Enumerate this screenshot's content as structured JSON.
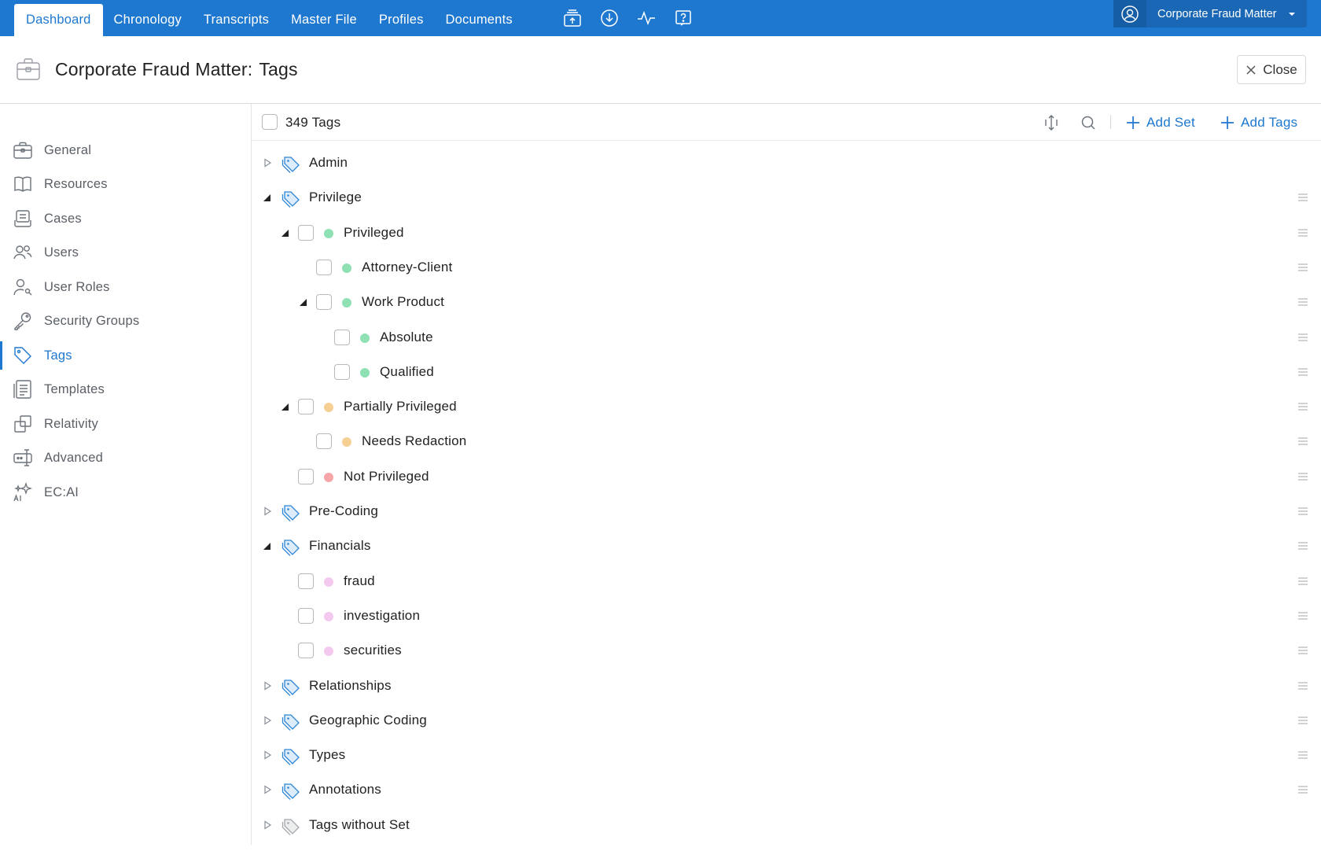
{
  "nav": {
    "tabs": [
      {
        "label": "Dashboard",
        "active": true
      },
      {
        "label": "Chronology"
      },
      {
        "label": "Transcripts"
      },
      {
        "label": "Master File"
      },
      {
        "label": "Profiles"
      },
      {
        "label": "Documents"
      }
    ],
    "icons": [
      "upload-stack-icon",
      "download-icon",
      "activity-icon",
      "help-icon"
    ],
    "matter": "Corporate Fraud Matter"
  },
  "header": {
    "title": "Corporate Fraud Matter:",
    "subtitle": "Tags",
    "close_label": "Close"
  },
  "sidebar": {
    "items": [
      {
        "label": "General",
        "icon": "briefcase-icon"
      },
      {
        "label": "Resources",
        "icon": "book-icon"
      },
      {
        "label": "Cases",
        "icon": "cases-icon"
      },
      {
        "label": "Users",
        "icon": "users-icon"
      },
      {
        "label": "User Roles",
        "icon": "user-roles-icon"
      },
      {
        "label": "Security Groups",
        "icon": "key-icon"
      },
      {
        "label": "Tags",
        "icon": "tag-icon",
        "active": true
      },
      {
        "label": "Templates",
        "icon": "templates-icon"
      },
      {
        "label": "Relativity",
        "icon": "relativity-icon"
      },
      {
        "label": "Advanced",
        "icon": "advanced-icon"
      },
      {
        "label": "EC:AI",
        "icon": "ai-sparkle-icon"
      }
    ]
  },
  "toolbar": {
    "count_label": "349 Tags",
    "add_set_label": "Add Set",
    "add_tags_label": "Add Tags"
  },
  "colors": {
    "accent": "#1e78cf",
    "green": "#8fe0b3",
    "orange": "#f5cf94",
    "red": "#f7a5a9",
    "pink": "#f3c9f0"
  },
  "tree": [
    {
      "label": "Admin",
      "kind": "set",
      "level": 0,
      "expanded": false
    },
    {
      "label": "Privilege",
      "kind": "set",
      "level": 0,
      "expanded": true
    },
    {
      "label": "Privileged",
      "kind": "tag",
      "level": 1,
      "color": "green",
      "expanded": true
    },
    {
      "label": "Attorney-Client",
      "kind": "tag",
      "level": 2,
      "color": "green"
    },
    {
      "label": "Work Product",
      "kind": "tag",
      "level": 2,
      "color": "green",
      "expanded": true
    },
    {
      "label": "Absolute",
      "kind": "tag",
      "level": 3,
      "color": "green"
    },
    {
      "label": "Qualified",
      "kind": "tag",
      "level": 3,
      "color": "green"
    },
    {
      "label": "Partially Privileged",
      "kind": "tag",
      "level": 1,
      "color": "orange",
      "expanded": true
    },
    {
      "label": "Needs Redaction",
      "kind": "tag",
      "level": 2,
      "color": "orange"
    },
    {
      "label": "Not Privileged",
      "kind": "tag",
      "level": 1,
      "color": "red"
    },
    {
      "label": "Pre-Coding",
      "kind": "set",
      "level": 0,
      "expanded": false
    },
    {
      "label": "Financials",
      "kind": "set",
      "level": 0,
      "expanded": true
    },
    {
      "label": "fraud",
      "kind": "tag",
      "level": 1,
      "color": "pink"
    },
    {
      "label": "investigation",
      "kind": "tag",
      "level": 1,
      "color": "pink"
    },
    {
      "label": "securities",
      "kind": "tag",
      "level": 1,
      "color": "pink"
    },
    {
      "label": "Relationships",
      "kind": "set",
      "level": 0,
      "expanded": false
    },
    {
      "label": "Geographic Coding",
      "kind": "set",
      "level": 0,
      "expanded": false
    },
    {
      "label": "Types",
      "kind": "set",
      "level": 0,
      "expanded": false
    },
    {
      "label": "Annotations",
      "kind": "set",
      "level": 0,
      "expanded": false
    },
    {
      "label": "Tags without Set",
      "kind": "set",
      "level": 0,
      "expanded": false,
      "muted": true
    }
  ]
}
